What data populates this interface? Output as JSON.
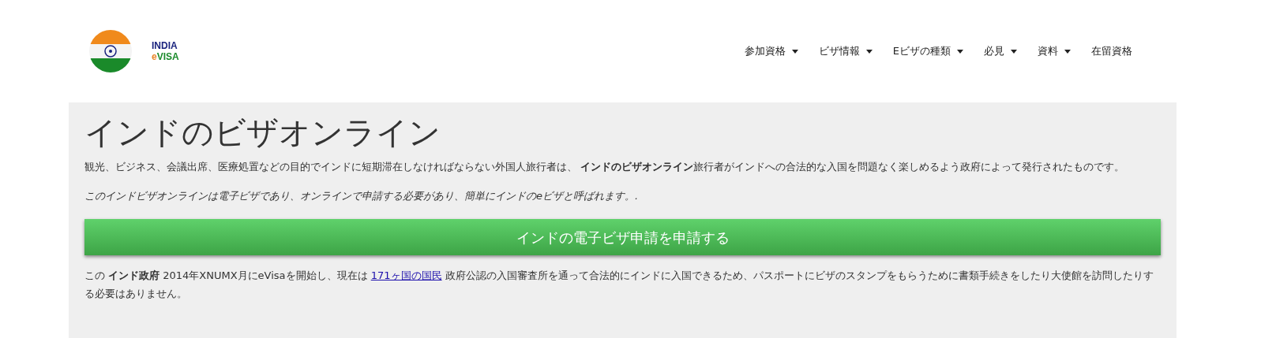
{
  "logo": {
    "line_1": "INDIA",
    "line_2_prefix": "e",
    "line_2_rest": "VISA"
  },
  "nav": [
    {
      "label": "参加資格",
      "dropdown": true
    },
    {
      "label": "ビザ情報",
      "dropdown": true
    },
    {
      "label": "Eビザの種類",
      "dropdown": true
    },
    {
      "label": "必見",
      "dropdown": true
    },
    {
      "label": "資料",
      "dropdown": true
    },
    {
      "label": "在留資格",
      "dropdown": false
    }
  ],
  "hero": {
    "title": "インドのビザオンライン",
    "intro": "観光、ビジネス、会議出席、医療処置などの目的でインドに短期滞在しなければならない外国人旅行者は、 **インドのビザオンライン**旅行者がインドへの合法的な入国を問題なく楽しめるよう政府によって発行されたものです。",
    "note": "このインドビザオンラインは電子ビザであり、オンラインで申請する必要があり、簡単にインドのeビザと呼ばれます。.",
    "apply_button": "インドの電子ビザ申請を申請する",
    "footer_before": "この **インド政府** 2014年XNUMX月にeVisaを開始し、現在は ",
    "footer_link": "171ヶ国の国民",
    "footer_after": " 政府公認の入国審査所を通って合法的にインドに入国できるため、パスポートにビザのスタンプをもらうために書類手続きをしたり大使館を訪問したりする必要はありません。"
  }
}
